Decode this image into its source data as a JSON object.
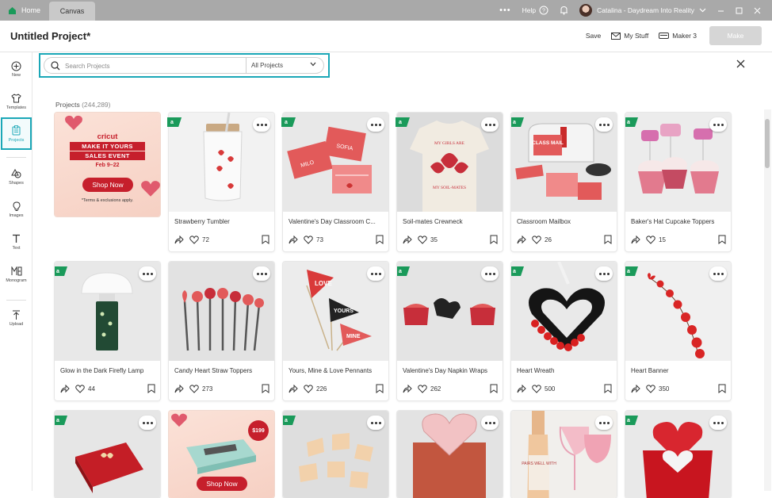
{
  "titlebar": {
    "home_label": "Home",
    "tab_label": "Canvas",
    "help_label": "Help",
    "user_label": "Catalina - Daydream Into Reality"
  },
  "header": {
    "project_title": "Untitled Project*",
    "save_label": "Save",
    "my_stuff_label": "My Stuff",
    "machine_label": "Maker 3",
    "make_label": "Make"
  },
  "sidebar": {
    "items": [
      {
        "label": "New",
        "icon": "plus-circle-icon"
      },
      {
        "label": "Templates",
        "icon": "shirt-icon"
      },
      {
        "label": "Projects",
        "icon": "clipboard-icon"
      },
      {
        "label": "Shapes",
        "icon": "shapes-icon"
      },
      {
        "label": "Images",
        "icon": "lightbulb-icon"
      },
      {
        "label": "Text",
        "icon": "text-icon"
      },
      {
        "label": "Monogram",
        "icon": "monogram-icon"
      },
      {
        "label": "Upload",
        "icon": "upload-icon"
      }
    ]
  },
  "search": {
    "placeholder": "Search Projects",
    "filter_value": "All Projects"
  },
  "projects": {
    "label": "Projects",
    "count": "(244,289)"
  },
  "promos": [
    {
      "brand": "cricut",
      "line1": "MAKE IT YOURS",
      "line2": "SALES EVENT",
      "date": "Feb 9–22",
      "button": "Shop Now",
      "terms": "*Terms & exclusions apply."
    },
    {
      "price": "$199",
      "button": "Shop Now"
    }
  ],
  "cards_row1": [
    {
      "title": "Strawberry Tumbler",
      "likes": "72"
    },
    {
      "title": "Valentine's Day Classroom C...",
      "likes": "73"
    },
    {
      "title": "Soil-mates Crewneck",
      "likes": "35"
    },
    {
      "title": "Classroom Mailbox",
      "likes": "26"
    },
    {
      "title": "Baker's Hat Cupcake Toppers",
      "likes": "15"
    }
  ],
  "cards_row2": [
    {
      "title": "Glow in the Dark Firefly Lamp",
      "likes": "44"
    },
    {
      "title": "Candy Heart Straw Toppers",
      "likes": "273"
    },
    {
      "title": "Yours, Mine & Love Pennants",
      "likes": "226"
    },
    {
      "title": "Valentine's Day Napkin Wraps",
      "likes": "262"
    },
    {
      "title": "Heart Wreath",
      "likes": "500"
    },
    {
      "title": "Heart Banner",
      "likes": "350"
    }
  ],
  "image_text": {
    "mailbox": "CLASS MAIL",
    "shirt": "MY GIRLS ARE MY SOIL-MATES",
    "pennant1": "LOVE",
    "pennant2": "YOURS",
    "pennant3": "MINE",
    "wine": "PAIRS WELL WITH"
  },
  "colors": {
    "accent": "#1ba7b7",
    "badge_green": "#1a9a5a",
    "cricut_red": "#c61f2c"
  }
}
